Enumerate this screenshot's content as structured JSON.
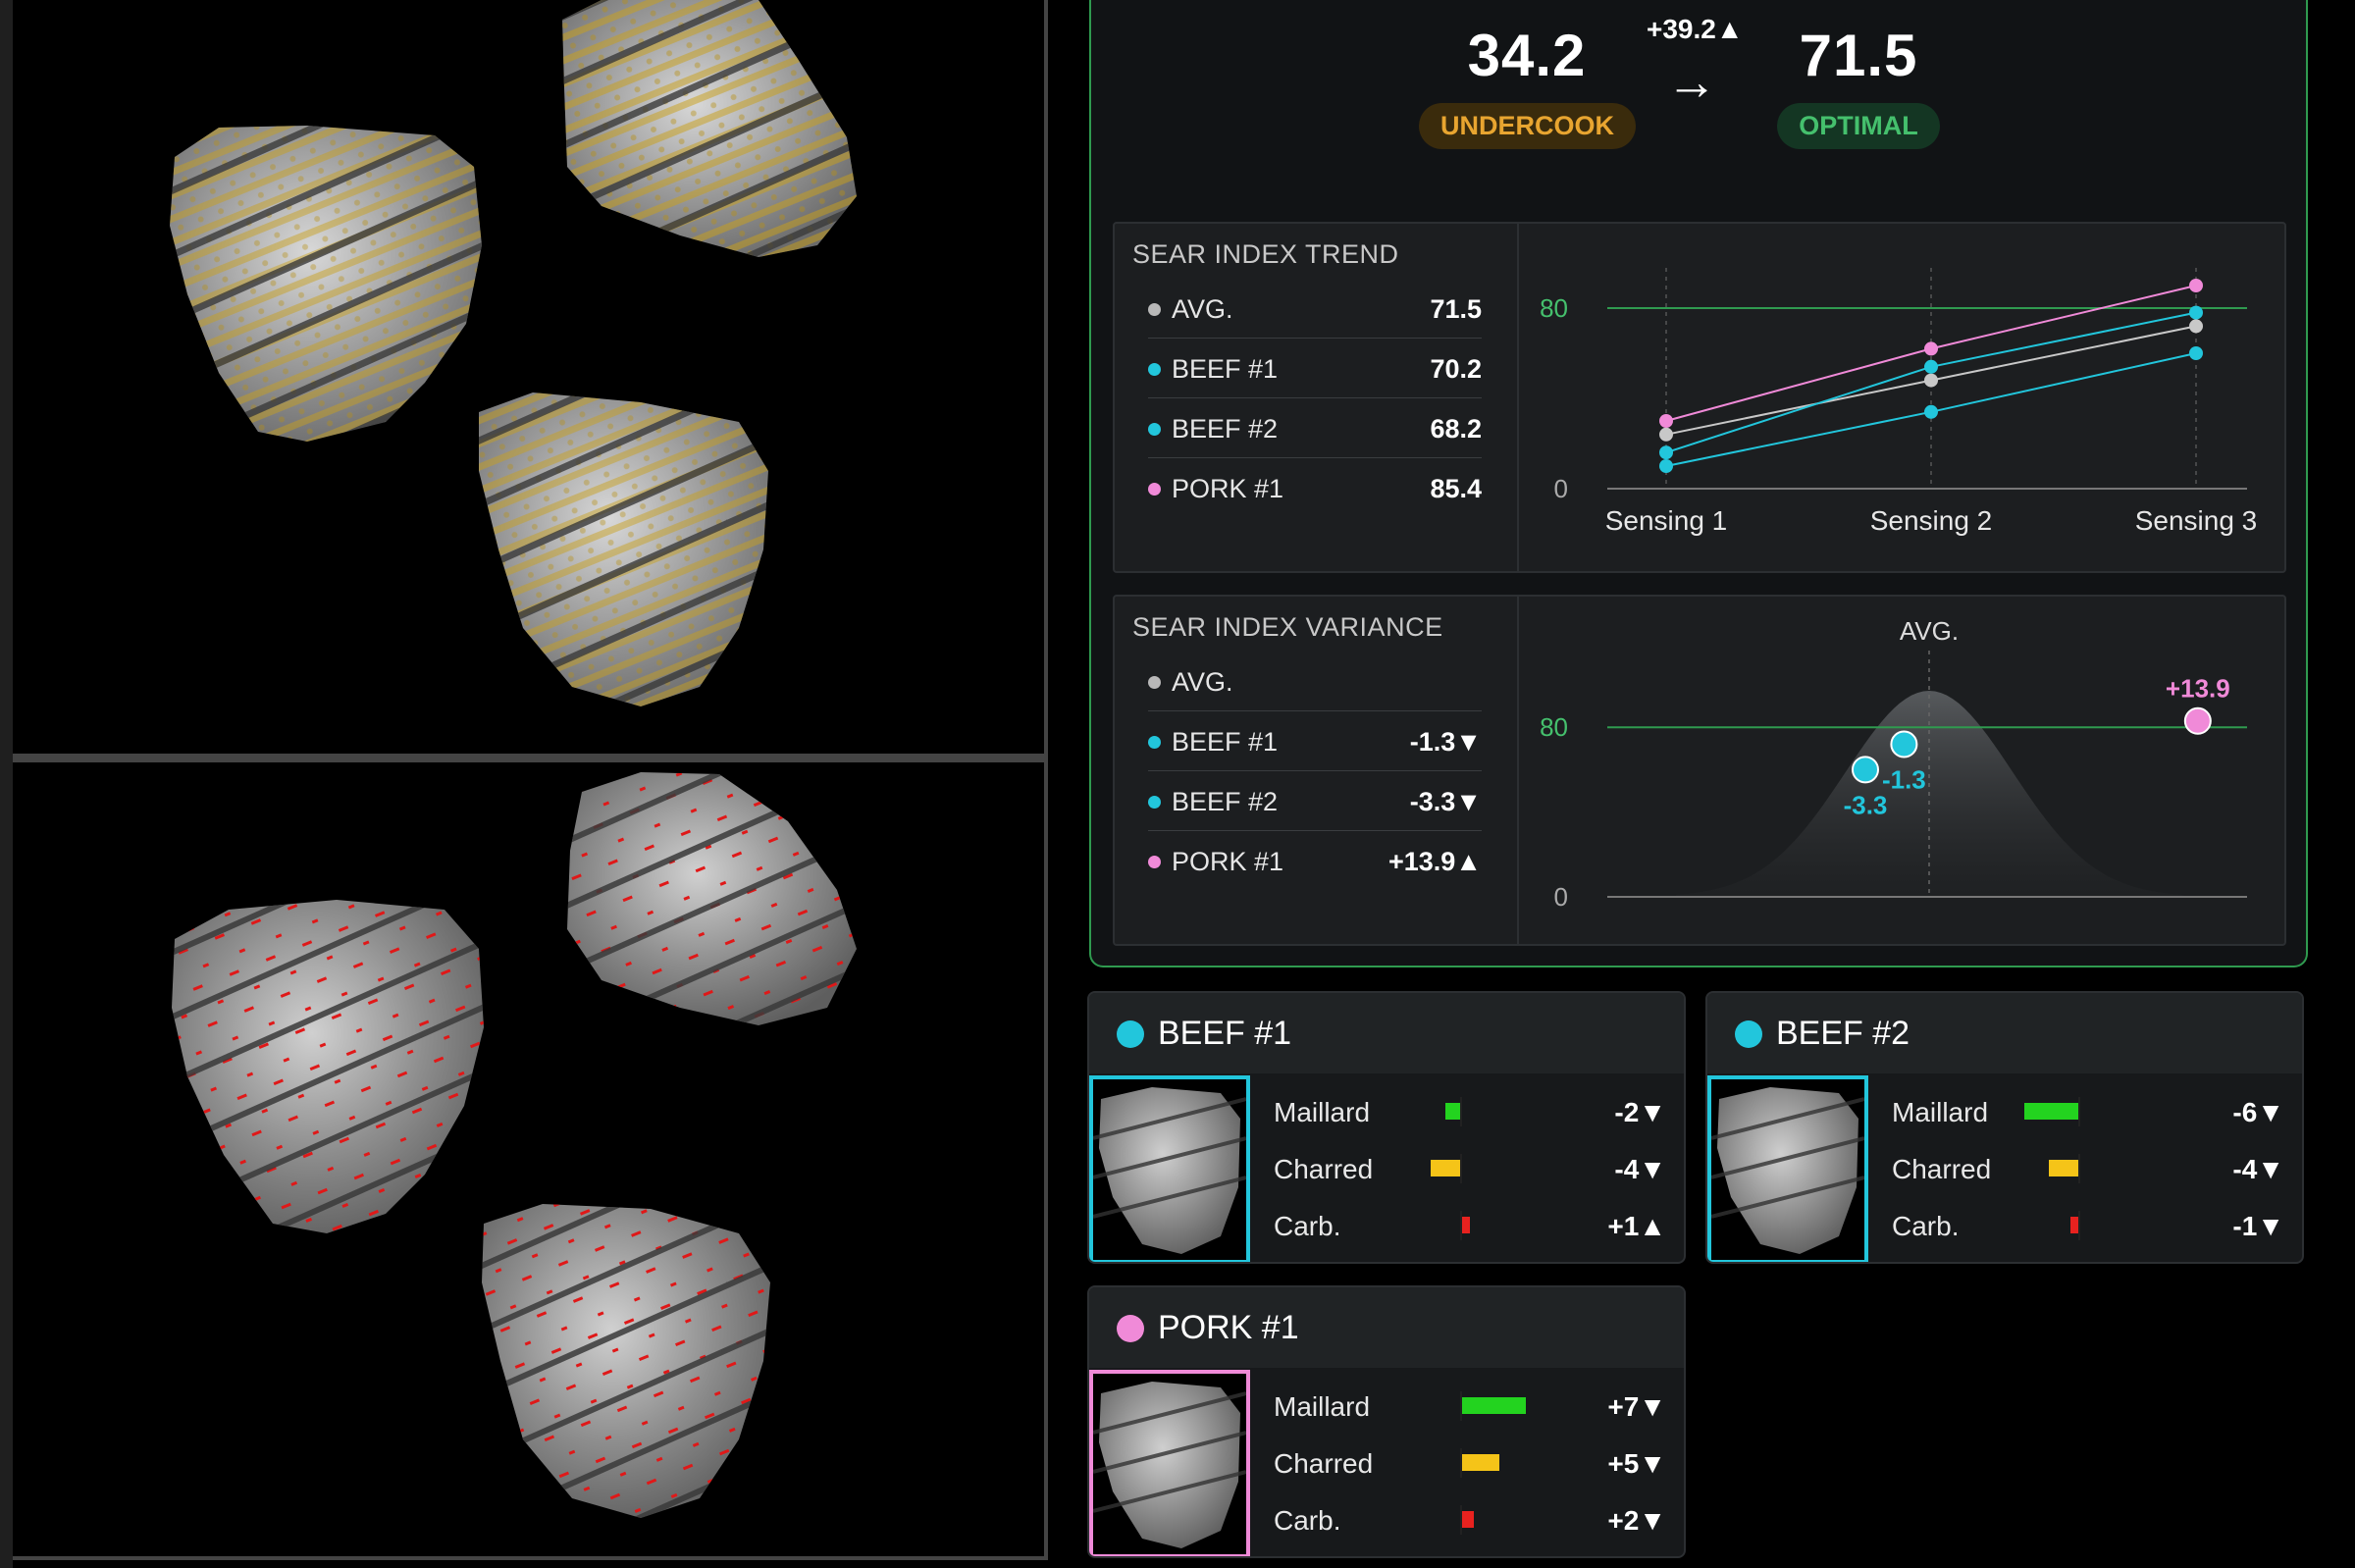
{
  "summary": {
    "before": {
      "value": "34.2",
      "status": "UNDERCOOK"
    },
    "after": {
      "value": "71.5",
      "status": "OPTIMAL"
    },
    "delta": "+39.2▲",
    "arrow": "→"
  },
  "trend": {
    "title": "SEAR INDEX TREND",
    "legend": [
      {
        "name": "AVG.",
        "value": "71.5",
        "color": "#b8b8b8"
      },
      {
        "name": "BEEF #1",
        "value": "70.2",
        "color": "#22c6dc"
      },
      {
        "name": "BEEF #2",
        "value": "68.2",
        "color": "#22c6dc"
      },
      {
        "name": "PORK #1",
        "value": "85.4",
        "color": "#f08ad8"
      }
    ]
  },
  "variance": {
    "title": "SEAR INDEX VARIANCE",
    "legend": [
      {
        "name": "AVG.",
        "value": "",
        "color": "#b8b8b8"
      },
      {
        "name": "BEEF #1",
        "value": "-1.3▼",
        "color": "#22c6dc"
      },
      {
        "name": "BEEF #2",
        "value": "-3.3▼",
        "color": "#22c6dc"
      },
      {
        "name": "PORK #1",
        "value": "+13.9▲",
        "color": "#f08ad8"
      }
    ]
  },
  "chart_data": [
    {
      "type": "line",
      "x": [
        "Sensing 1",
        "Sensing 2",
        "Sensing 3"
      ],
      "ylim": [
        0,
        100
      ],
      "yticks": [
        "0",
        "80"
      ],
      "reference_line": 80,
      "series": [
        {
          "name": "AVG.",
          "color": "#c8c8c8",
          "values": [
            24,
            48,
            72
          ]
        },
        {
          "name": "BEEF #1",
          "color": "#22c6dc",
          "values": [
            16,
            54,
            78
          ]
        },
        {
          "name": "BEEF #2",
          "color": "#22c6dc",
          "values": [
            10,
            34,
            60
          ]
        },
        {
          "name": "PORK #1",
          "color": "#f08ad8",
          "values": [
            30,
            62,
            90
          ]
        }
      ]
    },
    {
      "type": "scatter",
      "center_label": "AVG.",
      "ylim": [
        0,
        100
      ],
      "yticks": [
        "0",
        "80"
      ],
      "reference_line": 80,
      "points": [
        {
          "name": "BEEF #2",
          "label": "-3.3",
          "x": -3.3,
          "y": 60,
          "color": "#22c6dc"
        },
        {
          "name": "BEEF #1",
          "label": "-1.3",
          "x": -1.3,
          "y": 72,
          "color": "#22c6dc"
        },
        {
          "name": "PORK #1",
          "label": "+13.9",
          "x": 13.9,
          "y": 83,
          "color": "#f08ad8"
        }
      ]
    }
  ],
  "meats": [
    {
      "name": "BEEF #1",
      "color": "#22c6dc",
      "metrics": [
        {
          "label": "Maillard",
          "value": "-2▼",
          "amount": -0.15,
          "color": "#23d31f"
        },
        {
          "label": "Charred",
          "value": "-4▼",
          "amount": -0.3,
          "color": "#f5c418"
        },
        {
          "label": "Carb.",
          "value": "+1▲",
          "amount": 0.08,
          "color": "#e8221f"
        }
      ]
    },
    {
      "name": "BEEF #2",
      "color": "#22c6dc",
      "metrics": [
        {
          "label": "Maillard",
          "value": "-6▼",
          "amount": -0.55,
          "color": "#23d31f"
        },
        {
          "label": "Charred",
          "value": "-4▼",
          "amount": -0.3,
          "color": "#f5c418"
        },
        {
          "label": "Carb.",
          "value": "-1▼",
          "amount": -0.08,
          "color": "#e8221f"
        }
      ]
    },
    {
      "name": "PORK #1",
      "color": "#f08ad8",
      "metrics": [
        {
          "label": "Maillard",
          "value": "+7▼",
          "amount": 0.65,
          "color": "#23d31f"
        },
        {
          "label": "Charred",
          "value": "+5▼",
          "amount": 0.38,
          "color": "#f5c418"
        },
        {
          "label": "Carb.",
          "value": "+2▼",
          "amount": 0.12,
          "color": "#e8221f"
        }
      ]
    }
  ]
}
